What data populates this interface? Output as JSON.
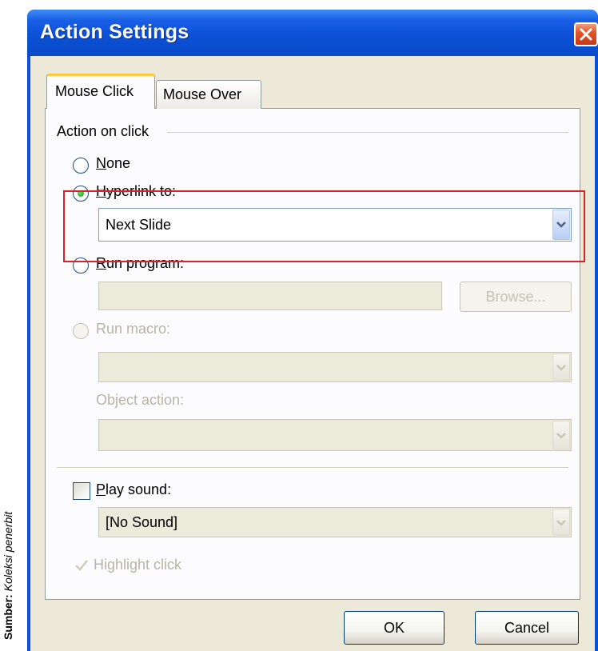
{
  "caption": {
    "label": "Sumber:",
    "text": "Koleksi penerbit"
  },
  "window": {
    "title": "Action Settings"
  },
  "tabs": [
    {
      "label": "Mouse Click"
    },
    {
      "label": "Mouse Over"
    }
  ],
  "group": {
    "label": "Action on click"
  },
  "options": {
    "none": {
      "label": "None"
    },
    "hyperlink": {
      "label": "Hyperlink to:",
      "value": "Next Slide"
    },
    "run_program": {
      "label": "Run program:",
      "browse_label": "Browse..."
    },
    "run_macro": {
      "label": "Run macro:"
    },
    "object_action": {
      "label": "Object action:"
    }
  },
  "sound": {
    "label": "Play sound:",
    "value": "[No Sound]"
  },
  "highlight": {
    "label": "Highlight click"
  },
  "buttons": {
    "ok": "OK",
    "cancel": "Cancel"
  },
  "colors": {
    "titlebar": "#0b50d6",
    "client": "#ece9d8",
    "highlight_box": "#d9232b",
    "tab_accent": "#ffc83c"
  }
}
